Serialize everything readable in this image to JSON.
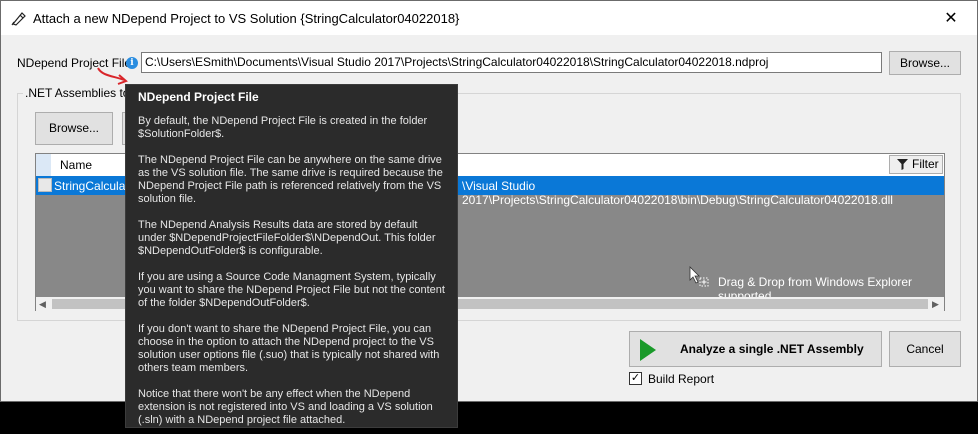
{
  "window": {
    "title": "Attach a new NDepend Project to VS Solution {StringCalculator04022018}",
    "close_glyph": "✕"
  },
  "project_file": {
    "label": "NDepend Project File:",
    "info_glyph": "i",
    "value": "C:\\Users\\ESmith\\Documents\\Visual Studio 2017\\Projects\\StringCalculator04022018\\StringCalculator04022018.ndproj",
    "browse_label": "Browse..."
  },
  "assemblies": {
    "group_label": ".NET Assemblies to A",
    "browse_label": "Browse...",
    "column_name": "Name",
    "filter_label": "Filter",
    "row": {
      "name": "StringCalculato",
      "path": "\\Visual Studio 2017\\Projects\\StringCalculator04022018\\bin\\Debug\\StringCalculator04022018.dll"
    },
    "drop_hint": "Drag & Drop from Windows Explorer supported",
    "scroll_left": "◀",
    "scroll_right": "▶"
  },
  "actions": {
    "analyze_label": "Analyze a single .NET Assembly",
    "cancel_label": "Cancel",
    "build_report_label": "Build Report",
    "build_report_checked": true,
    "check_glyph": "✓"
  },
  "tooltip": {
    "title": "NDepend Project File",
    "paragraphs": [
      "By default, the NDepend Project File is created in the folder $SolutionFolder$.",
      "The NDepend Project File can be anywhere on the same drive as the VS solution file. The same drive is required because the NDepend Project File path is referenced relatively from the VS solution file.",
      "The NDepend Analysis Results data are stored by default under $NDependProjectFileFolder$\\NDependOut. This folder $NDependOutFolder$ is configurable.",
      "If you are using a Source Code Managment System, typically you want to share the NDepend Project File but not the content of the folder $NDependOutFolder$.",
      "If you don't want to share the NDepend Project File, you can choose in the option to attach the NDepend project to the VS solution user options file (.suo) that is typically not shared with others team members.",
      "Notice that there won't be any effect when the NDepend extension is not registered into VS and loading a VS solution (.sln) with a NDepend project file attached."
    ]
  },
  "colors": {
    "selection": "#0a78d7",
    "tooltip_bg": "#2b2b2b",
    "play_green": "#1a9a2a",
    "info_blue": "#2a8de0",
    "arrow_red": "#d9262b"
  }
}
